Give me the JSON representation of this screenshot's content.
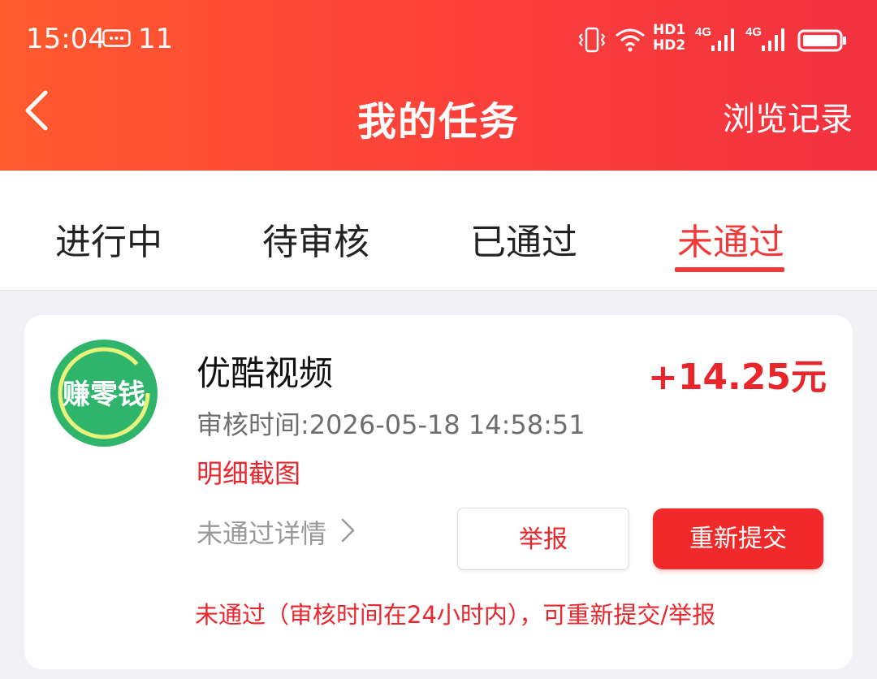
{
  "status_bar": {
    "time": "15:04",
    "notification_count": "11",
    "network_hd": [
      "HD1",
      "HD2"
    ],
    "network_type": "4G"
  },
  "header": {
    "title": "我的任务",
    "right_link": "浏览记录"
  },
  "tabs": [
    {
      "label": "进行中",
      "active": false
    },
    {
      "label": "待审核",
      "active": false
    },
    {
      "label": "已通过",
      "active": false
    },
    {
      "label": "未通过",
      "active": true
    }
  ],
  "task": {
    "logo_text": "赚零钱",
    "name": "优酷视频",
    "reward": "+14.25元",
    "review_time": "审核时间:2026-05-18 14:58:51",
    "detail_screenshot_label": "明细截图",
    "reject_details_label": "未通过详情",
    "report_button": "举报",
    "resubmit_button": "重新提交",
    "notice": "未通过（审核时间在24小时内），可重新提交/举报"
  },
  "colors": {
    "header_gradient_start": "#ff5a2e",
    "header_gradient_end": "#f2323f",
    "accent_red": "#e8262c",
    "logo_green": "#2fb56b"
  }
}
